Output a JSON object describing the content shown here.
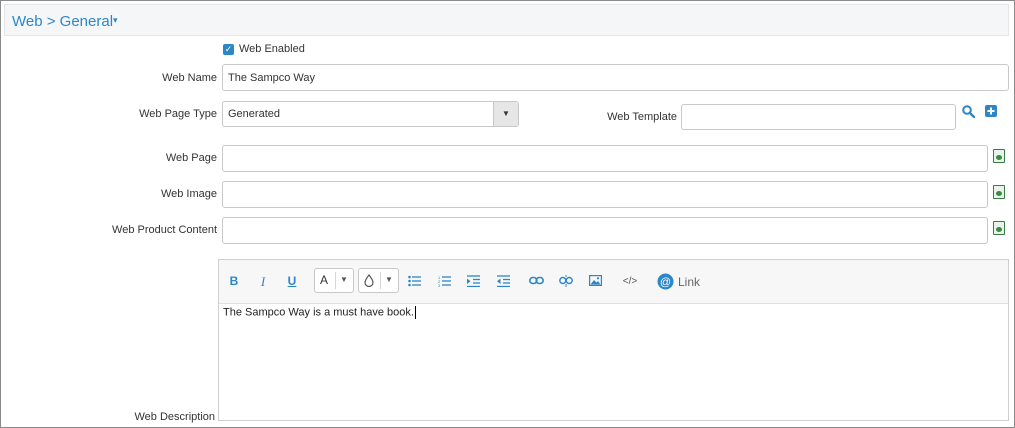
{
  "header": {
    "title": "Web > General",
    "caret": "▾"
  },
  "web_enabled": {
    "label": "Web Enabled",
    "checked": true
  },
  "fields": {
    "web_name": {
      "label": "Web Name",
      "value": "The Sampco Way"
    },
    "web_page_type": {
      "label": "Web Page Type",
      "value": "Generated"
    },
    "web_template": {
      "label": "Web Template",
      "value": ""
    },
    "web_page": {
      "label": "Web Page",
      "value": ""
    },
    "web_image": {
      "label": "Web Image",
      "value": ""
    },
    "web_product_content": {
      "label": "Web Product Content",
      "value": ""
    },
    "web_description": {
      "label": "Web Description"
    }
  },
  "editor": {
    "toolbar": {
      "bold": "B",
      "italic": "I",
      "underline": "U",
      "font_color": "A",
      "link_label": "Link"
    },
    "content": "The Sampco Way is a must have book."
  },
  "colors": {
    "accent": "#2b87c7",
    "attach_green": "#3a8a48"
  }
}
